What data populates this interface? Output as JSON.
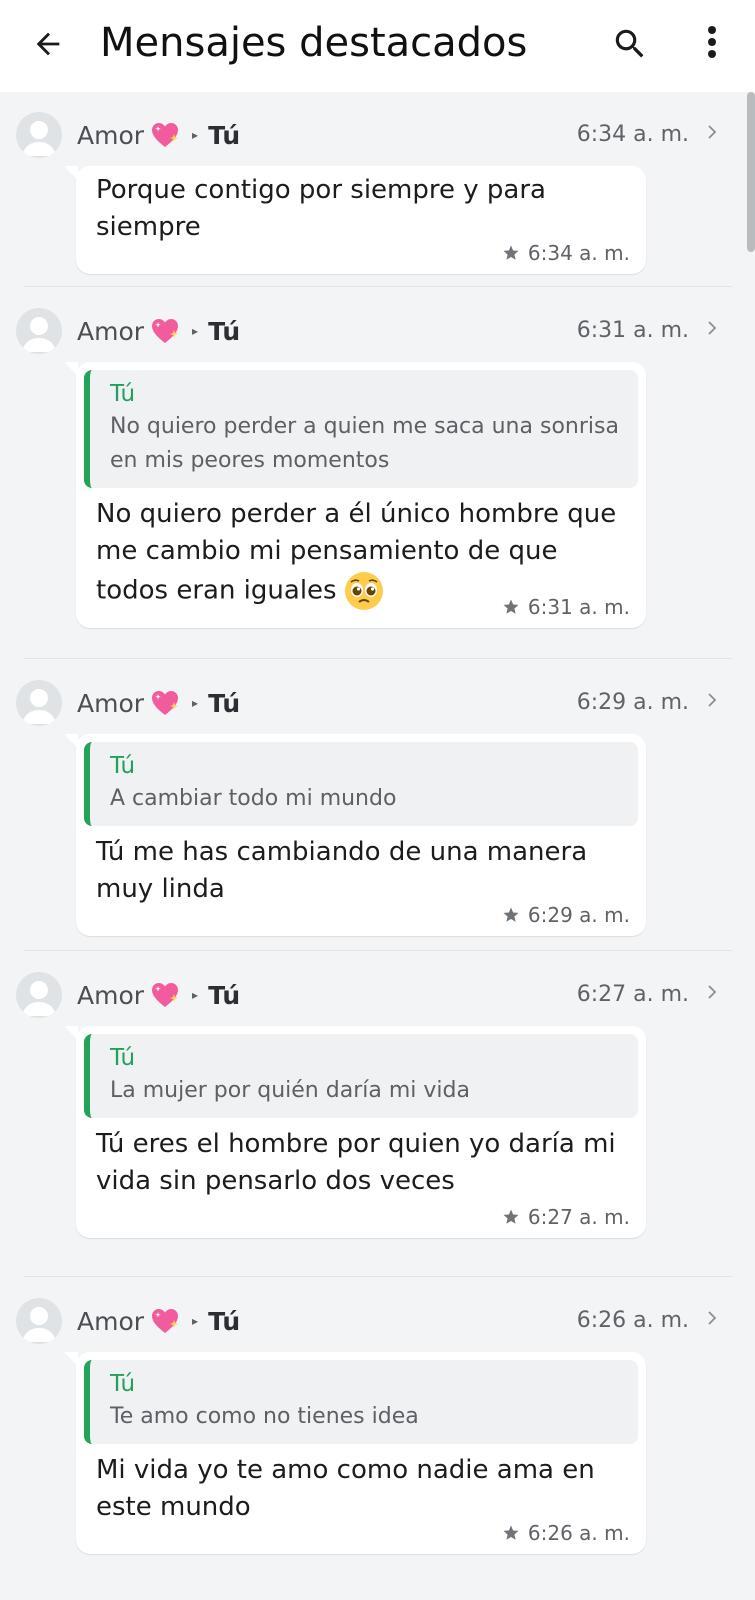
{
  "appbar": {
    "title": "Mensajes destacados",
    "back_icon": "arrow-left-icon",
    "search_icon": "search-icon",
    "more_icon": "more-vertical-icon"
  },
  "colors": {
    "appbar_bg": "#ffffff",
    "page_bg": "#f3f4f6",
    "quote_accent": "#21a35a",
    "quote_author": "#24a05a"
  },
  "items": [
    {
      "sender": "Amor",
      "recipient": "Tú",
      "time": "6:34 a. m.",
      "quote_author": "",
      "quote_text": "",
      "message": "Porque contigo por siempre y para siempre",
      "message_emoji": "",
      "meta_time": "6:34 a. m."
    },
    {
      "sender": "Amor",
      "recipient": "Tú",
      "time": "6:31 a. m.",
      "quote_author": "Tú",
      "quote_text": "No quiero perder a quien me saca una sonrisa en mis peores momentos",
      "message": "No quiero perder a él único hombre que me cambio mi pensamiento de que todos eran iguales",
      "message_emoji": "pleading-face",
      "meta_time": "6:31 a. m."
    },
    {
      "sender": "Amor",
      "recipient": "Tú",
      "time": "6:29 a. m.",
      "quote_author": "Tú",
      "quote_text": "A cambiar todo mi mundo",
      "message": "Tú me has cambiando de una manera muy linda",
      "message_emoji": "",
      "meta_time": "6:29 a. m."
    },
    {
      "sender": "Amor",
      "recipient": "Tú",
      "time": "6:27 a. m.",
      "quote_author": "Tú",
      "quote_text": "La mujer por quién daría mi vida",
      "message": "Tú eres el hombre por quien yo daría mi vida sin pensarlo dos veces",
      "message_emoji": "",
      "meta_time": "6:27 a. m."
    },
    {
      "sender": "Amor",
      "recipient": "Tú",
      "time": "6:26 a. m.",
      "quote_author": "Tú",
      "quote_text": "Te amo como no tienes idea",
      "message": "Mi vida yo te amo como nadie ama en este mundo",
      "message_emoji": "",
      "meta_time": "6:26 a. m."
    }
  ]
}
